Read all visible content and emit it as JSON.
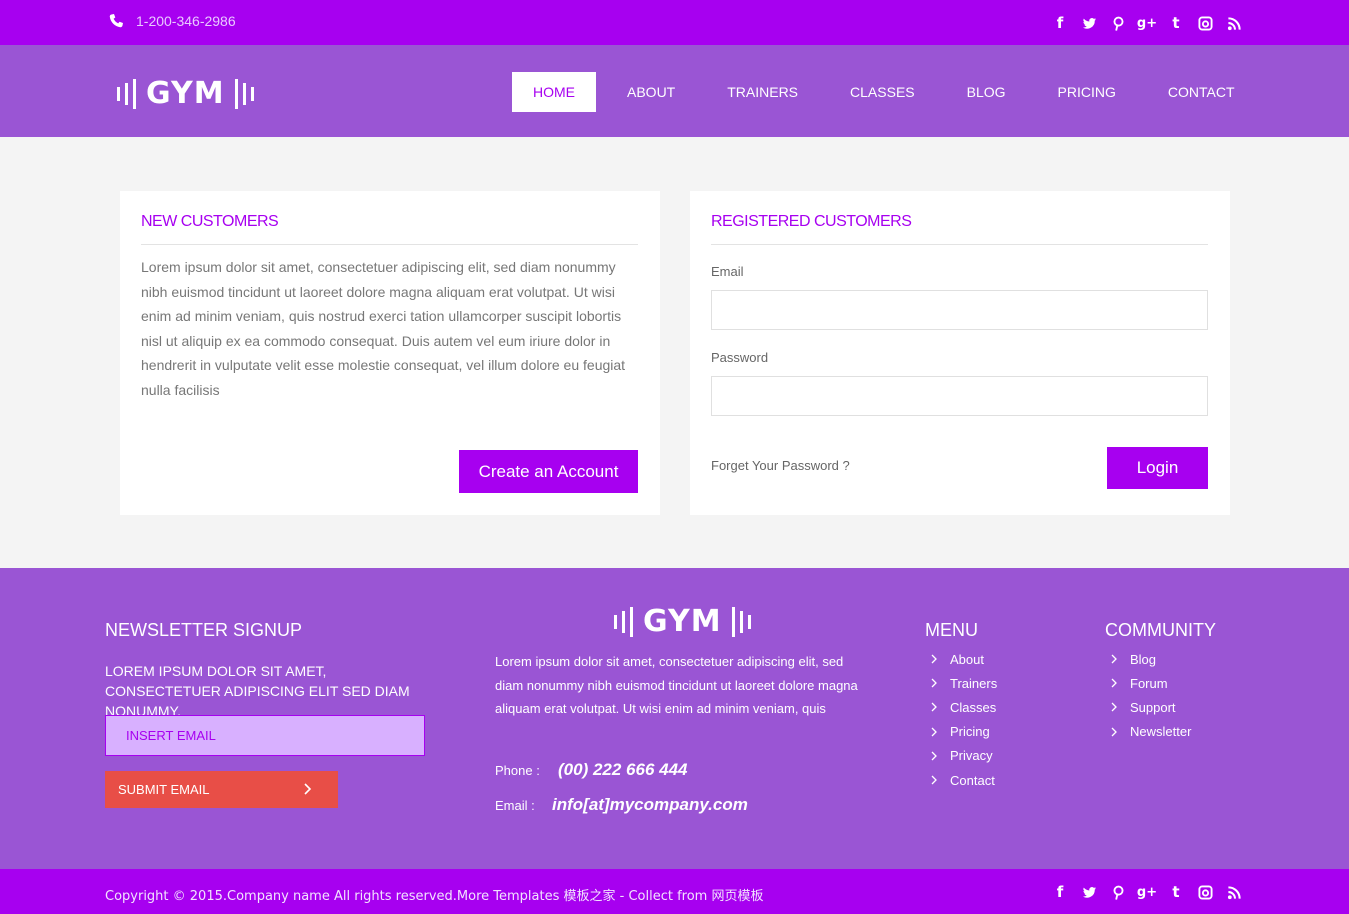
{
  "topbar": {
    "phone": "1-200-346-2986",
    "social_icons": [
      "facebook-icon",
      "twitter-icon",
      "pinterest-icon",
      "google-plus-icon",
      "tumblr-icon",
      "instagram-icon",
      "rss-icon"
    ]
  },
  "header": {
    "logo_text": "GYM",
    "nav": [
      {
        "label": "HOME",
        "active": true
      },
      {
        "label": "ABOUT"
      },
      {
        "label": "TRAINERS"
      },
      {
        "label": "CLASSES"
      },
      {
        "label": "BLOG"
      },
      {
        "label": "PRICING"
      },
      {
        "label": "CONTACT"
      }
    ]
  },
  "new_customers": {
    "title": "NEW CUSTOMERS",
    "text": "Lorem ipsum dolor sit amet, consectetuer adipiscing elit, sed diam nonummy nibh euismod tincidunt ut laoreet dolore magna aliquam erat volutpat. Ut wisi enim ad minim veniam, quis nostrud exerci tation ullamcorper suscipit lobortis nisl ut aliquip ex ea commodo consequat. Duis autem vel eum iriure dolor in hendrerit in vulputate velit esse molestie consequat, vel illum dolore eu feugiat nulla facilisis",
    "button": "Create an Account"
  },
  "registered_customers": {
    "title": "REGISTERED CUSTOMERS",
    "email_label": "Email",
    "email_value": "",
    "password_label": "Password",
    "password_value": "",
    "forgot": "Forget Your Password ?",
    "button": "Login"
  },
  "footer": {
    "newsletter": {
      "title": "NEWSLETTER SIGNUP",
      "text": "LOREM IPSUM DOLOR SIT AMET, CONSECTETUER ADIPISCING ELIT SED DIAM NONUMMY.",
      "placeholder": "INSERT EMAIL",
      "submit": "SUBMIT EMAIL"
    },
    "logo_text": "GYM",
    "about": "Lorem ipsum dolor sit amet, consectetuer adipiscing elit, sed diam nonummy nibh euismod tincidunt ut laoreet dolore magna aliquam erat volutpat. Ut wisi enim ad minim veniam, quis",
    "phone_label": "Phone :",
    "phone": "(00) 222 666 444",
    "email_label": "Email :",
    "email": "info[at]mycompany.com",
    "menu": {
      "title": "MENU",
      "items": [
        "About",
        "Trainers",
        "Classes",
        "Pricing",
        "Privacy",
        "Contact"
      ]
    },
    "community": {
      "title": "COMMUNITY",
      "items": [
        "Blog",
        "Forum",
        "Support",
        "Newsletter"
      ]
    },
    "copyright": "Copyright © 2015.Company name All rights reserved.More Templates 模板之家 - Collect from 网页模板"
  },
  "colors": {
    "brand_purple": "#a700f0",
    "header_purple": "#9a55d4",
    "submit_red": "#e84e47"
  }
}
